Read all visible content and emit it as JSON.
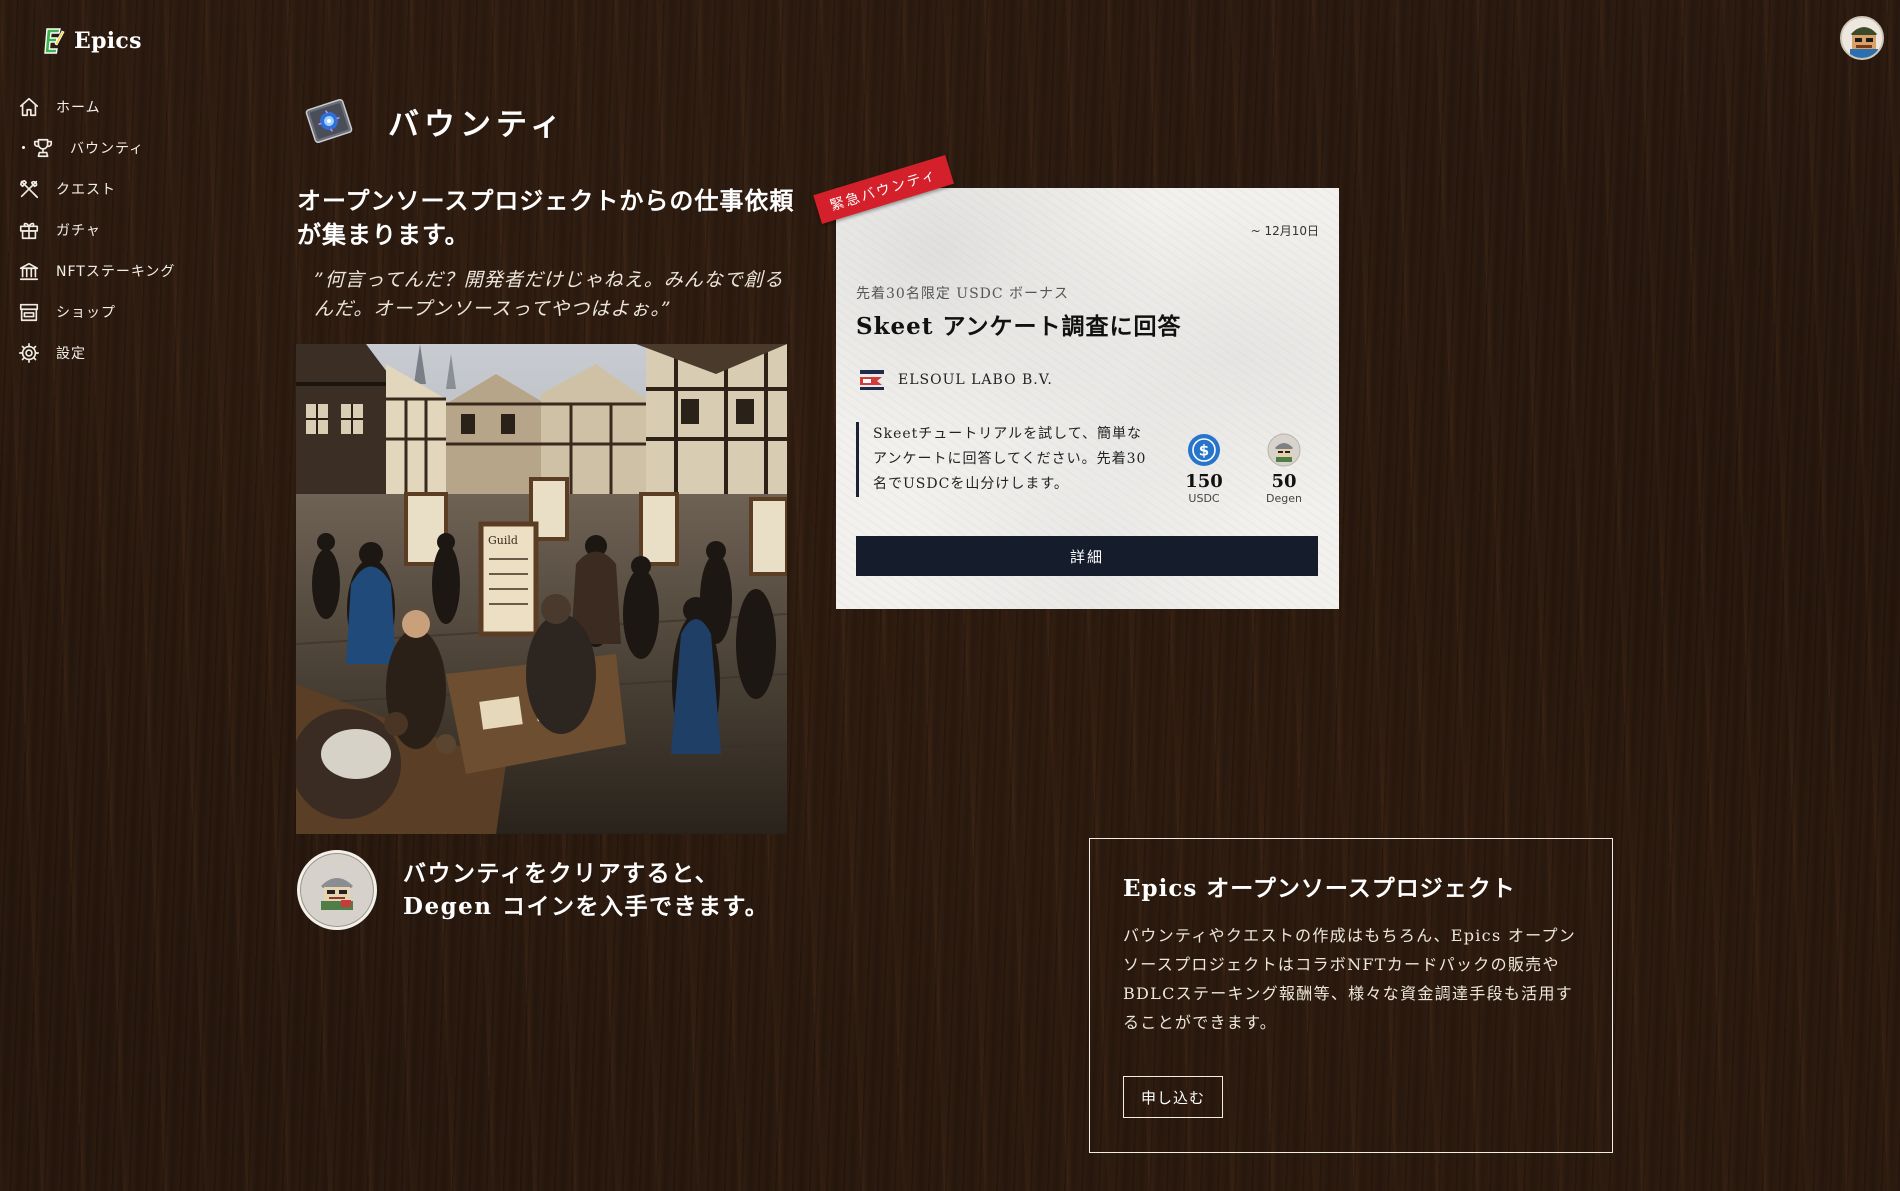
{
  "app": {
    "name": "Epics"
  },
  "sidebar": {
    "items": [
      {
        "label": "ホーム",
        "icon": "home-icon"
      },
      {
        "label": "バウンティ",
        "icon": "trophy-icon",
        "active": true
      },
      {
        "label": "クエスト",
        "icon": "tools-icon"
      },
      {
        "label": "ガチャ",
        "icon": "gift-icon"
      },
      {
        "label": "NFTステーキング",
        "icon": "bank-icon"
      },
      {
        "label": "ショップ",
        "icon": "store-icon"
      },
      {
        "label": "設定",
        "icon": "gear-icon"
      }
    ]
  },
  "header": {
    "title": "バウンティ"
  },
  "intro": {
    "lead": "オープンソースプロジェクトからの仕事依頼が集まります。",
    "quote": "”何言ってんだ？開発者だけじゃねえ。みんなで創るんだ。オープンソースってやつはよぉ。”",
    "degen_line1": "バウンティをクリアすると、",
    "degen_line2": "Degen コインを入手できます。"
  },
  "bounty_card": {
    "ribbon": "緊急バウンティ",
    "date": "~ 12月10日",
    "subtitle": "先着30名限定 USDC ボーナス",
    "title": "Skeet アンケート調査に回答",
    "org": "ELSOUL LABO B.V.",
    "description": "Skeetチュートリアルを試して、簡単なアンケートに回答してください。先着30名でUSDCを山分けします。",
    "rewards": [
      {
        "amount": "150",
        "unit": "USDC",
        "icon": "usdc-coin-icon",
        "color": "#2775ca"
      },
      {
        "amount": "50",
        "unit": "Degen",
        "icon": "degen-coin-icon",
        "color": "#cfcac2"
      }
    ],
    "button": "詳細"
  },
  "project": {
    "title": "Epics オープンソースプロジェクト",
    "description": "バウンティやクエストの作成はもちろん、Epics オープンソースプロジェクトはコラボNFTカードパックの販売やBDLCステーキング報酬等、様々な資金調達手段も活用することができます。",
    "button": "申し込む"
  },
  "colors": {
    "accent": "#d3202a",
    "button_dark": "#151c2c",
    "usdc": "#2775ca"
  }
}
